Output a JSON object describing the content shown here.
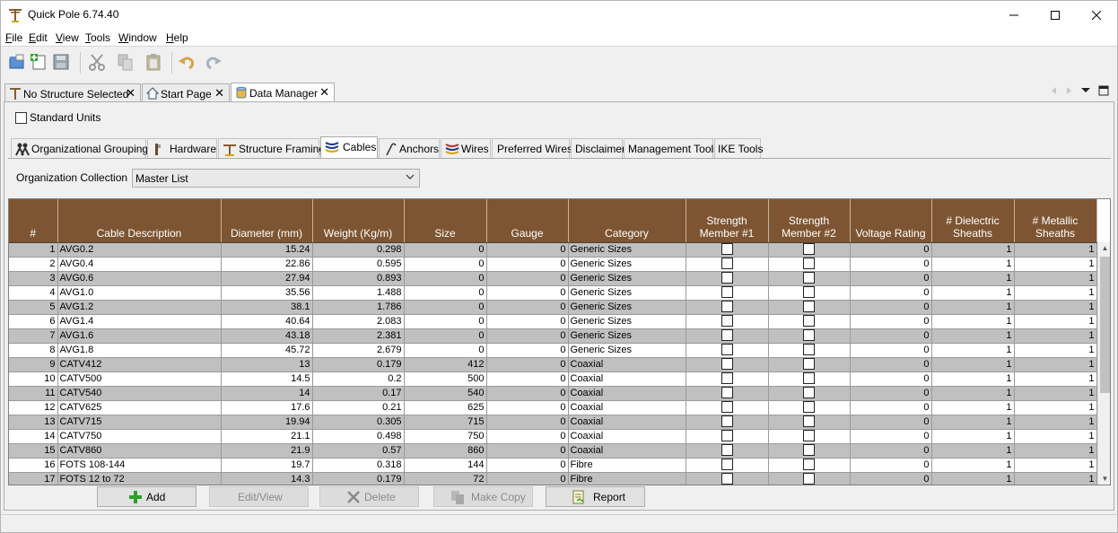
{
  "window": {
    "title": "Quick Pole 6.74.40"
  },
  "menu": [
    "File",
    "Edit",
    "View",
    "Tools",
    "Window",
    "Help"
  ],
  "doc_tabs": [
    {
      "label": "No Structure Selected",
      "icon": "pole-icon"
    },
    {
      "label": "Start Page",
      "icon": "home-icon"
    },
    {
      "label": "Data Manager",
      "icon": "database-icon"
    }
  ],
  "standard_units": {
    "label": "Standard Units",
    "checked": false
  },
  "sub_tabs": [
    {
      "label": "Organizational Groupings",
      "icon": "people-icon"
    },
    {
      "label": "Hardware",
      "icon": "hardware-icon"
    },
    {
      "label": "Structure Framing",
      "icon": "framing-icon"
    },
    {
      "label": "Cables",
      "icon": "cables-icon"
    },
    {
      "label": "Anchors",
      "icon": "anchor-icon"
    },
    {
      "label": "Wires",
      "icon": "wires-icon"
    },
    {
      "label": "Preferred Wires",
      "icon": ""
    },
    {
      "label": "Disclaimer",
      "icon": ""
    },
    {
      "label": "Management Tools",
      "icon": ""
    },
    {
      "label": "IKE Tools",
      "icon": ""
    }
  ],
  "org": {
    "label": "Organization Collection",
    "value": "Master List"
  },
  "table": {
    "headers": [
      "#",
      "Cable Description",
      "Diameter (mm)",
      "Weight (Kg/m)",
      "Size",
      "Gauge",
      "Category",
      "Strength Member #1",
      "Strength Member #2",
      "Voltage Rating",
      "# Dielectric Sheaths",
      "# Metallic Sheaths"
    ],
    "rows": [
      [
        "1",
        "AVG0.2",
        "15.24",
        "0.298",
        "0",
        "0",
        "Generic Sizes",
        "0",
        "1",
        "1"
      ],
      [
        "2",
        "AVG0.4",
        "22.86",
        "0.595",
        "0",
        "0",
        "Generic Sizes",
        "0",
        "1",
        "1"
      ],
      [
        "3",
        "AVG0.6",
        "27.94",
        "0.893",
        "0",
        "0",
        "Generic Sizes",
        "0",
        "1",
        "1"
      ],
      [
        "4",
        "AVG1.0",
        "35.56",
        "1.488",
        "0",
        "0",
        "Generic Sizes",
        "0",
        "1",
        "1"
      ],
      [
        "5",
        "AVG1.2",
        "38.1",
        "1.786",
        "0",
        "0",
        "Generic Sizes",
        "0",
        "1",
        "1"
      ],
      [
        "6",
        "AVG1.4",
        "40.64",
        "2.083",
        "0",
        "0",
        "Generic Sizes",
        "0",
        "1",
        "1"
      ],
      [
        "7",
        "AVG1.6",
        "43.18",
        "2.381",
        "0",
        "0",
        "Generic Sizes",
        "0",
        "1",
        "1"
      ],
      [
        "8",
        "AVG1.8",
        "45.72",
        "2.679",
        "0",
        "0",
        "Generic Sizes",
        "0",
        "1",
        "1"
      ],
      [
        "9",
        "CATV412",
        "13",
        "0.179",
        "412",
        "0",
        "Coaxial",
        "0",
        "1",
        "1"
      ],
      [
        "10",
        "CATV500",
        "14.5",
        "0.2",
        "500",
        "0",
        "Coaxial",
        "0",
        "1",
        "1"
      ],
      [
        "11",
        "CATV540",
        "14",
        "0.17",
        "540",
        "0",
        "Coaxial",
        "0",
        "1",
        "1"
      ],
      [
        "12",
        "CATV625",
        "17.6",
        "0.21",
        "625",
        "0",
        "Coaxial",
        "0",
        "1",
        "1"
      ],
      [
        "13",
        "CATV715",
        "19.94",
        "0.305",
        "715",
        "0",
        "Coaxial",
        "0",
        "1",
        "1"
      ],
      [
        "14",
        "CATV750",
        "21.1",
        "0.498",
        "750",
        "0",
        "Coaxial",
        "0",
        "1",
        "1"
      ],
      [
        "15",
        "CATV860",
        "21.9",
        "0.57",
        "860",
        "0",
        "Coaxial",
        "0",
        "1",
        "1"
      ],
      [
        "16",
        "FOTS 108-144",
        "19.7",
        "0.318",
        "144",
        "0",
        "Fibre",
        "0",
        "1",
        "1"
      ],
      [
        "17",
        "FOTS 12 to 72",
        "14.3",
        "0.179",
        "72",
        "0",
        "Fibre",
        "0",
        "1",
        "1"
      ]
    ]
  },
  "buttons": [
    {
      "label": "Add",
      "enabled": true,
      "icon": "plus-icon"
    },
    {
      "label": "Edit/View",
      "enabled": false,
      "icon": ""
    },
    {
      "label": "Delete",
      "enabled": false,
      "icon": "x-icon"
    },
    {
      "label": "Make Copy",
      "enabled": false,
      "icon": "copy-icon"
    },
    {
      "label": "Report",
      "enabled": true,
      "icon": "report-icon"
    }
  ]
}
